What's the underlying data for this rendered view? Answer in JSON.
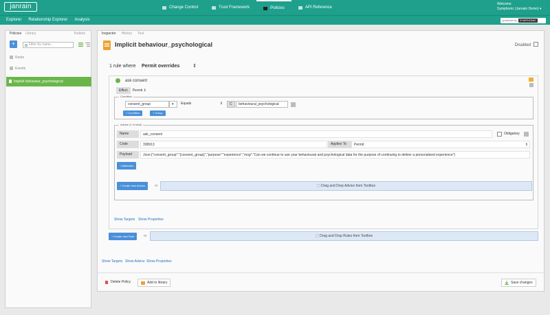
{
  "app": {
    "logo_text": "janrain"
  },
  "topnav": {
    "items": [
      {
        "label": "Change Control"
      },
      {
        "label": "Trust Framework"
      },
      {
        "label": "Policies"
      },
      {
        "label": "API Reference"
      }
    ],
    "welcome_label": "Welcome",
    "user_name": "Symphonic (Janrain Demo) ▾"
  },
  "subnav": {
    "items": [
      {
        "label": "Explorer"
      },
      {
        "label": "Relationship Explorer"
      },
      {
        "label": "Analysis"
      }
    ],
    "powered_by": "powered by",
    "powered_brand": "SYMPHONIC"
  },
  "left": {
    "tabs": [
      {
        "label": "Policies"
      },
      {
        "label": "Library"
      }
    ],
    "toolbox_label": "Toolbox",
    "add_button": "+",
    "filter_placeholder": "Filter by name...",
    "sections": [
      {
        "label": "Roots"
      },
      {
        "label": "Events"
      }
    ],
    "active_item": "Implicit behaviour_psychological"
  },
  "main": {
    "tabs": [
      {
        "label": "Inspector"
      },
      {
        "label": "History"
      },
      {
        "label": "Test"
      }
    ],
    "title": "Implicit behaviour_psychological",
    "disabled_label": "Disabled",
    "rule_where": "1 rule where",
    "combining_algorithm": "Permit overrides",
    "rule": {
      "name": "ask consent",
      "effect_label": "Effect",
      "effect_value": "Permit ⇕",
      "condition_legend": "Condition",
      "condition_attr": "consent_group",
      "condition_op": "Equals",
      "condition_type": "C",
      "condition_value": "behavioural_psychological",
      "add_condition": "+ Condition",
      "add_group": "+ Group",
      "advice_legend": "Advice (1 in total)",
      "advice_name_label": "Name",
      "advice_name": "ask_consent",
      "obligatory_label": "Obligatory",
      "advice_code_label": "Code",
      "advice_code": "338913",
      "applies_to_label": "Applies To",
      "applies_to_value": "Permit",
      "payload_label": "Payload",
      "payload": "Json:{\"consent_group\":\"{consent_group}\",\"purpose\":\"experience\",\"msg\":\"Can we continue to use your behavioural and psychological data for the purpose of continuing to deliver a personalized experience\"}",
      "attributes_button": "+ Attributes",
      "create_advice": "+ Create new Advice",
      "or_label": "or",
      "drop_advice": "Drag and Drop Advice from Toolbox",
      "show_targets": "Show Targets",
      "show_properties": "Show Properties"
    },
    "create_rule": "+ Create new Rule",
    "or_label": "or",
    "drop_rules": "Drag and Drop Rules from Toolbox",
    "bottom_links": [
      {
        "label": "Show Targets"
      },
      {
        "label": "Show Advice"
      },
      {
        "label": "Show Properties"
      }
    ],
    "footer": {
      "delete_label": "Delete Policy",
      "library_label": "Add to library",
      "save_label": "Save changes"
    }
  },
  "colors": {
    "brand": "#1ea08c",
    "accent": "#4a90d9",
    "active": "#6ab64a"
  }
}
